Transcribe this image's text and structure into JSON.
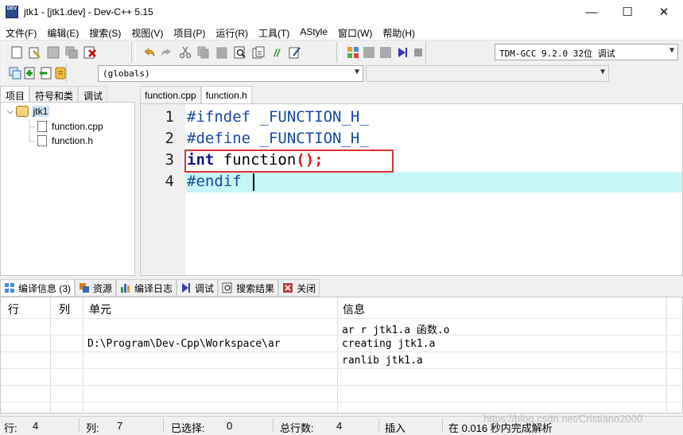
{
  "window": {
    "icon_text": "DEV",
    "title": "jtk1 - [jtk1.dev] - Dev-C++ 5.15",
    "minimize": "—",
    "maximize": "☐",
    "close": "✕"
  },
  "menu": [
    "文件(F)",
    "编辑(E)",
    "搜索(S)",
    "视图(V)",
    "项目(P)",
    "运行(R)",
    "工具(T)",
    "AStyle",
    "窗口(W)",
    "帮助(H)"
  ],
  "toolbar": {
    "compiler_select": "TDM-GCC 9.2.0 32位 调试",
    "scope_select": "(globals)",
    "member_select": ""
  },
  "left_tabs": [
    "项目",
    "符号和类",
    "调试"
  ],
  "project_tree": {
    "project": "jtk1",
    "files": [
      "function.cpp",
      "function.h"
    ]
  },
  "editor": {
    "tabs": [
      "function.cpp",
      "function.h"
    ],
    "active_tab": "function.h",
    "line_numbers": [
      "1",
      "2",
      "3",
      "4"
    ],
    "lines": [
      {
        "directive": "#ifndef",
        "rest": " _FUNCTION_H_"
      },
      {
        "directive": "#define",
        "rest": " _FUNCTION_H_"
      },
      {
        "keyword": "int",
        "name": " function",
        "punct": "();"
      },
      {
        "directive": "#endif",
        "rest": ""
      }
    ]
  },
  "bottom_tabs": [
    "编译信息 (3)",
    "资源",
    "编译日志",
    "调试",
    "搜索结果",
    "关闭"
  ],
  "compile_table": {
    "headers": [
      "行",
      "列",
      "单元",
      "信息"
    ],
    "rows": [
      {
        "line": "",
        "col": "",
        "unit": "",
        "info": "ar r jtk1.a 函数.o"
      },
      {
        "line": "",
        "col": "",
        "unit": "D:\\Program\\Dev-Cpp\\Workspace\\ar",
        "info": "creating jtk1.a"
      },
      {
        "line": "",
        "col": "",
        "unit": "",
        "info": "ranlib jtk1.a"
      }
    ]
  },
  "status": {
    "row_label": "行:",
    "row_value": "4",
    "col_label": "列:",
    "col_value": "7",
    "sel_label": "已选择:",
    "sel_value": "0",
    "total_label": "总行数:",
    "total_value": "4",
    "mode": "插入",
    "parse_msg": "在 0.016 秒内完成解析"
  },
  "watermark": "https://blog.csdn.net/Cristiano2000"
}
